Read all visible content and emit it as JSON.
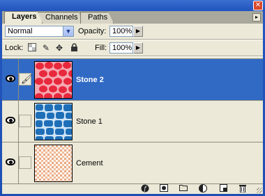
{
  "window": {
    "close_glyph": "✕"
  },
  "tabs": [
    {
      "label": "Layers",
      "active": true
    },
    {
      "label": "Channels",
      "active": false
    },
    {
      "label": "Paths",
      "active": false
    }
  ],
  "options": {
    "blend_mode": "Normal",
    "opacity_label": "Opacity:",
    "opacity_value": "100%",
    "lock_label": "Lock:",
    "fill_label": "Fill:",
    "fill_value": "100%",
    "lock_icons": [
      "lock-transparent-icon",
      "lock-image-brush-icon",
      "lock-position-move-icon",
      "lock-all-padlock-icon"
    ]
  },
  "layers": [
    {
      "name": "Stone 2",
      "selected": true,
      "visible": true,
      "linked_brush": true,
      "thumb_colors": {
        "base": "#f5a8b2",
        "fill": "#e8283c"
      }
    },
    {
      "name": "Stone 1",
      "selected": false,
      "visible": true,
      "linked_brush": false,
      "thumb_colors": {
        "base": "#cfe4f5",
        "fill": "#1f6fb8"
      }
    },
    {
      "name": "Cement",
      "selected": false,
      "visible": true,
      "linked_brush": false,
      "thumb_colors": {
        "base": "#ffffff",
        "fill": "#e8a883"
      }
    }
  ],
  "footer_icons": [
    "layer-styles-icon",
    "layer-mask-icon",
    "new-group-folder-icon",
    "adjustment-layer-icon",
    "new-layer-icon",
    "delete-layer-trash-icon"
  ],
  "colors": {
    "selection": "#316ac5",
    "panel": "#ece9d8",
    "window_blue": "#2456bf"
  }
}
